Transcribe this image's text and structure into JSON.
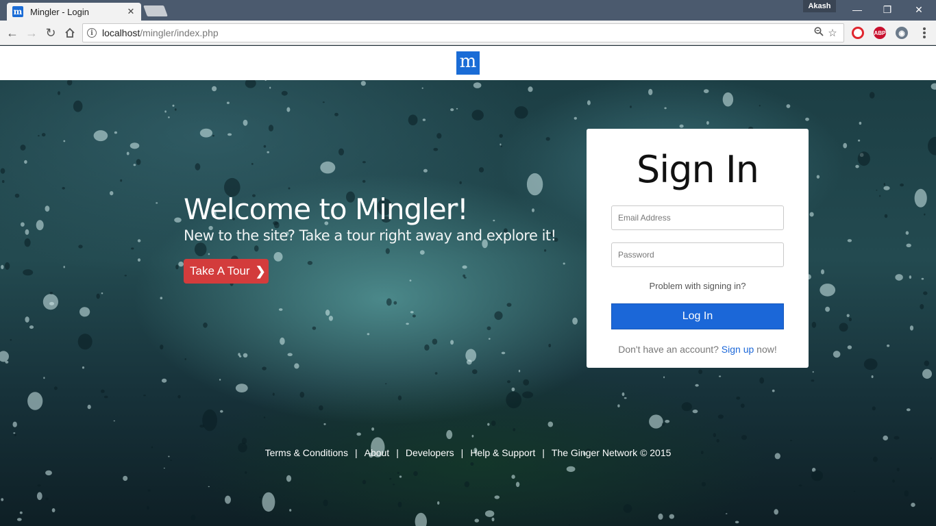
{
  "browser": {
    "tab_title": "Mingler - Login",
    "tab_favicon": "m",
    "profile_name": "Akash",
    "url_host": "localhost",
    "url_path": "/mingler/index.php",
    "extensions": [
      {
        "name": "opera-icon",
        "label": "O",
        "color": "#e0262e"
      },
      {
        "name": "adblock-plus-icon",
        "label": "ABP",
        "color": "#c8102e"
      },
      {
        "name": "extension-eye-icon",
        "label": "◉",
        "color": "#6b7a8a"
      }
    ]
  },
  "header": {
    "logo_letter": "m"
  },
  "hero": {
    "title": "Welcome to Mingler!",
    "subtitle": "New to the site? Take a tour right away and explore it!",
    "tour_button": "Take A Tour",
    "tour_chevron": "❯"
  },
  "signin": {
    "title": "Sign In",
    "email_placeholder": "Email Address",
    "password_placeholder": "Password",
    "problem_link": "Problem with signing in?",
    "login_button": "Log In",
    "signup_prefix": "Don't have an account?",
    "signup_link": "Sign up",
    "signup_suffix": "now!"
  },
  "footer": {
    "links": [
      "Terms & Conditions",
      "About",
      "Developers",
      "Help & Support"
    ],
    "copyright": "The Ginger Network © 2015",
    "separator": "|"
  },
  "colors": {
    "accent_blue": "#1b67d8",
    "tour_red": "#d33c3c"
  }
}
